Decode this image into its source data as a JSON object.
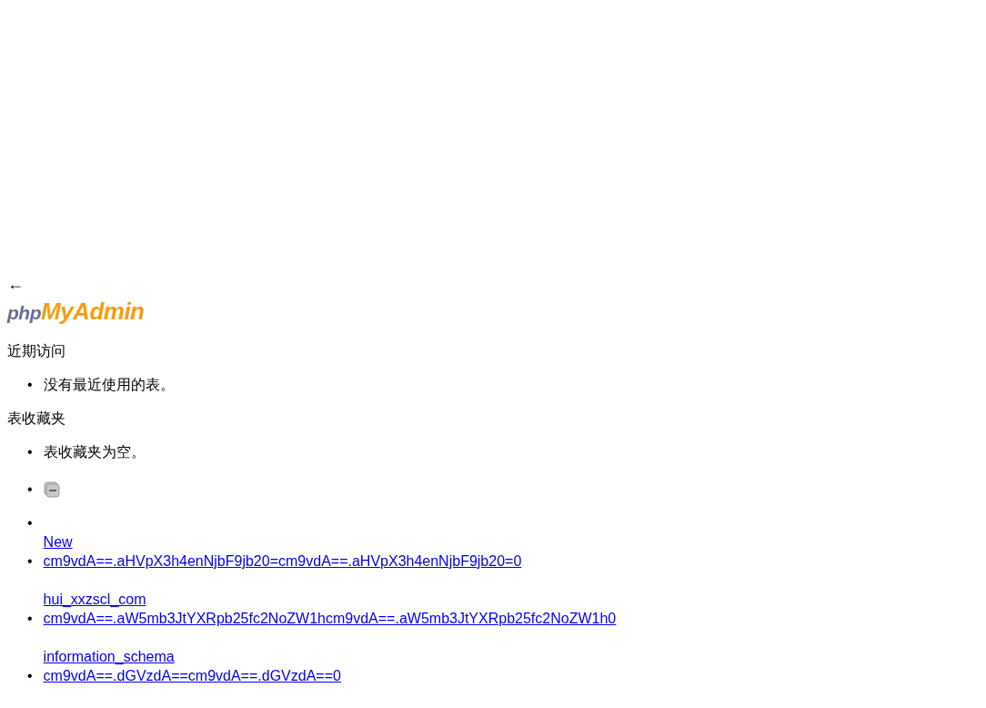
{
  "back_arrow": "←",
  "logo": {
    "prefix": "php",
    "suffix": "MyAdmin"
  },
  "recent": {
    "title": "近期访问",
    "items": [
      {
        "marker": "•",
        "text": "没有最近使用的表。"
      }
    ]
  },
  "favorites": {
    "title": "表收藏夹",
    "items": [
      {
        "marker": "•",
        "text": "表收藏夹为空。"
      }
    ]
  },
  "tree": [
    {
      "kind": "collapse",
      "marker": "•"
    },
    {
      "kind": "new",
      "marker": "•",
      "label": "New"
    },
    {
      "kind": "node",
      "marker": "•",
      "code": "cm9vdA==.aHVpX3h4enNjbF9jb20=cm9vdA==.aHVpX3h4enNjbF9jb20=0",
      "next_label": "hui_xxzscl_com"
    },
    {
      "kind": "node",
      "marker": "•",
      "code": "cm9vdA==.aW5mb3JtYXRpb25fc2NoZW1hcm9vdA==.aW5mb3JtYXRpb25fc2NoZW1h0",
      "next_label": "information_schema"
    },
    {
      "kind": "node",
      "marker": "•",
      "code": "cm9vdA==.dGVzdA==cm9vdA==.dGVzdA==0"
    }
  ]
}
